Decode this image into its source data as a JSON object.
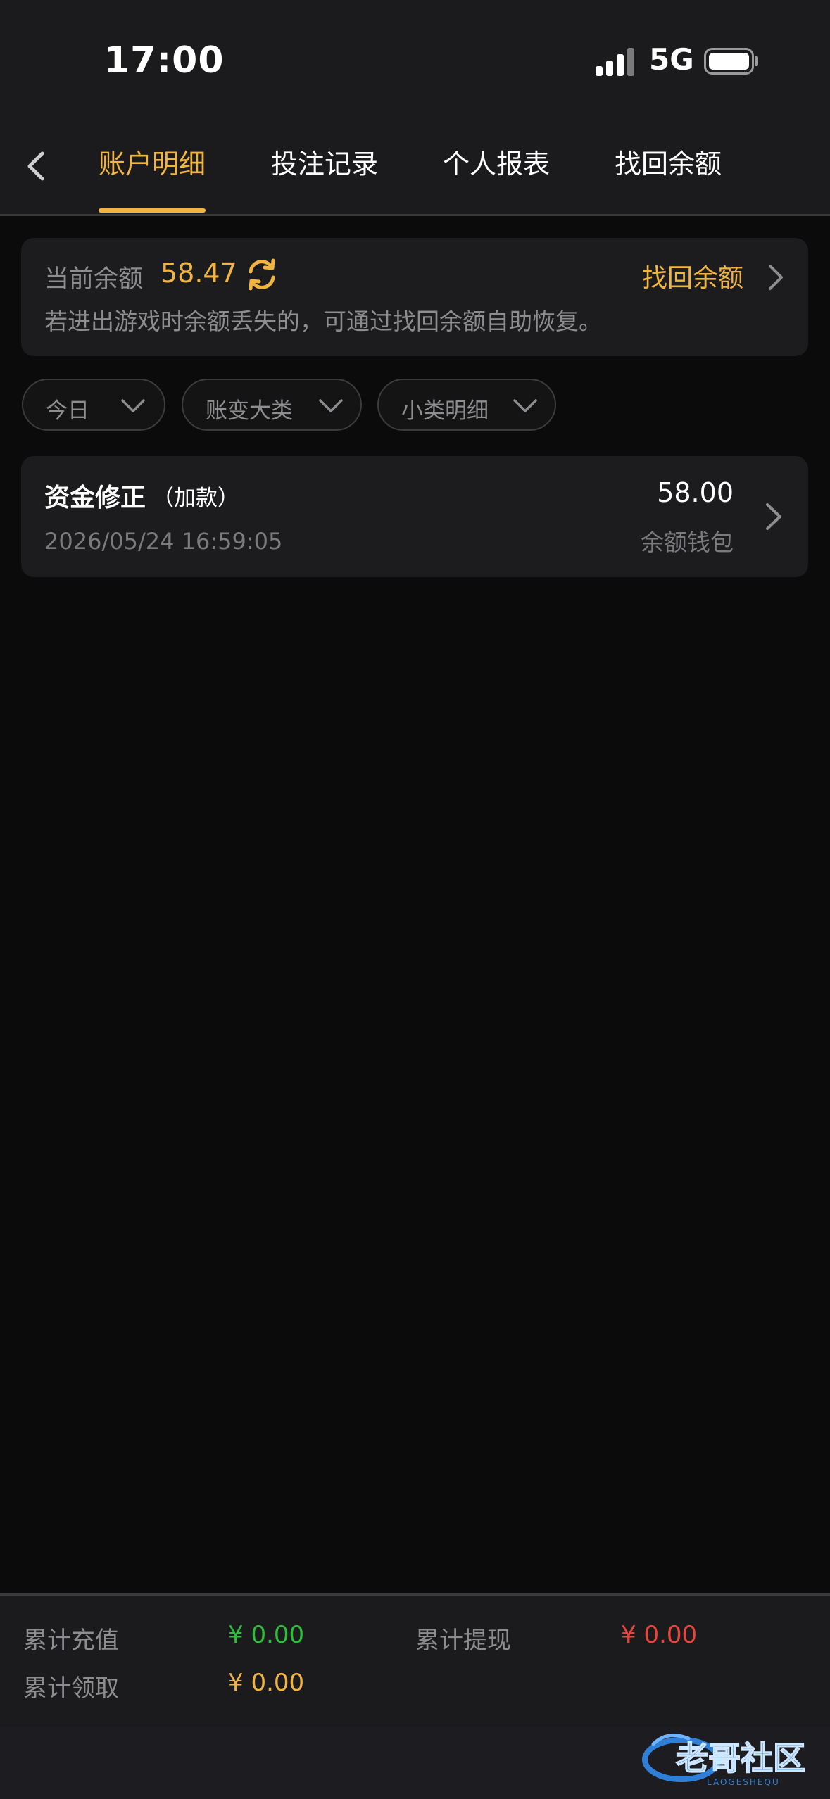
{
  "status_bar": {
    "time": "17:00",
    "network": "5G"
  },
  "nav": {
    "tabs": [
      {
        "label": "账户明细",
        "active": true
      },
      {
        "label": "投注记录",
        "active": false
      },
      {
        "label": "个人报表",
        "active": false
      },
      {
        "label": "找回余额",
        "active": false
      }
    ]
  },
  "balance": {
    "label": "当前余额",
    "amount": "58.47",
    "recover_label": "找回余额",
    "hint": "若进出游戏时余额丢失的，可通过找回余额自助恢复。"
  },
  "filters": [
    {
      "label": "今日"
    },
    {
      "label": "账变大类"
    },
    {
      "label": "小类明细"
    }
  ],
  "records": [
    {
      "title": "资金修正",
      "subtitle": "（加款）",
      "datetime": "2026/05/24 16:59:05",
      "amount": "58.00",
      "wallet": "余额钱包"
    }
  ],
  "summary": {
    "total_recharge_label": "累计充值",
    "total_recharge_value": "¥ 0.00",
    "total_withdraw_label": "累计提现",
    "total_withdraw_value": "¥ 0.00",
    "total_claim_label": "累计领取",
    "total_claim_value": "¥ 0.00"
  },
  "colors": {
    "accent": "#f0b440",
    "recharge": "#2bbf3a",
    "withdraw": "#e8463c",
    "claim": "#f0b440"
  },
  "watermark": {
    "text": "老哥社区",
    "subtext": "LAOGESHEQU"
  }
}
